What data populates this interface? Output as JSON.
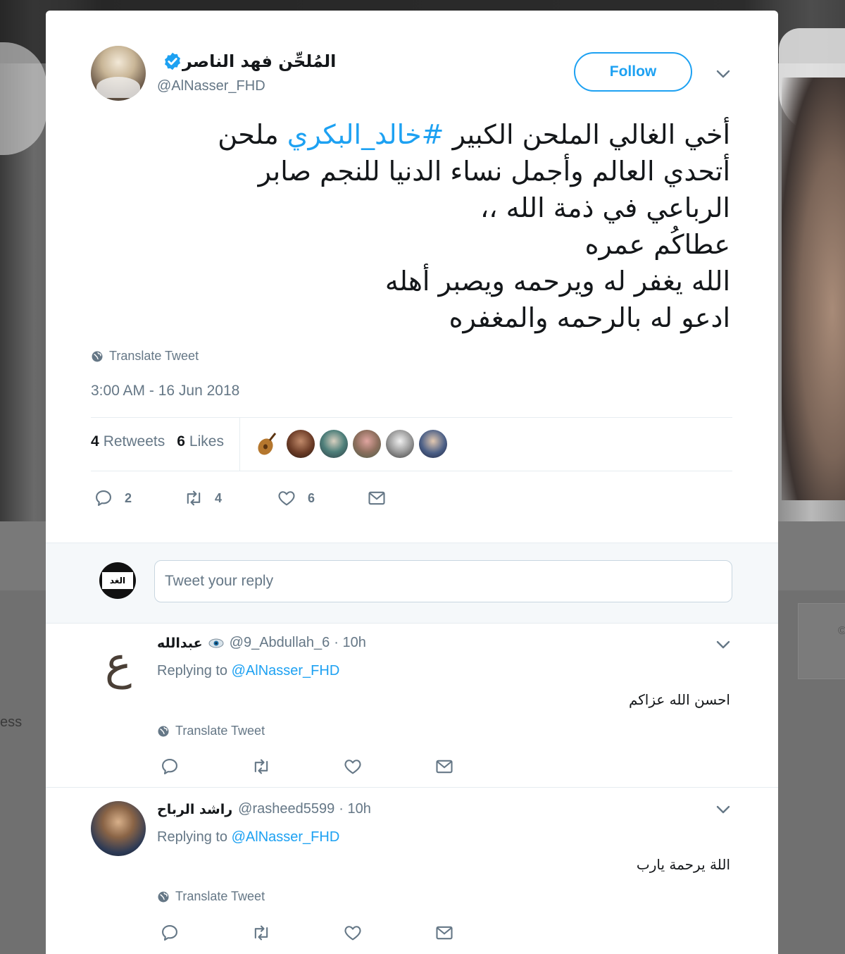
{
  "tweet": {
    "display_name": "المُلحِّن فهد الناصر",
    "handle": "@AlNasser_FHD",
    "follow_label": "Follow",
    "text_lines": [
      [
        "أخي الغالي  الملحن الكبير ",
        "#خالد_البكري",
        " ملحن"
      ],
      "أتحدي العالم وأجمل نساء الدنيا للنجم صابر",
      "الرباعي في ذمة الله ،،",
      "عطاكُم عمره",
      "الله  يغفر له ويرحمه ويصبر أهله",
      "ادعو له بالرحمه والمغفره"
    ],
    "translate_label": "Translate Tweet",
    "timestamp": "3:00 AM - 16 Jun 2018",
    "retweets_count": "4",
    "retweets_label": "Retweets",
    "likes_count": "6",
    "likes_label": "Likes",
    "actions": {
      "reply_count": "2",
      "retweet_count": "4",
      "like_count": "6"
    }
  },
  "reply_box": {
    "placeholder": "Tweet your reply",
    "avatar_text": "الغد"
  },
  "replies": [
    {
      "name": "عبدالله",
      "handle": "@9_Abdullah_6",
      "time": "· 10h",
      "replying_prefix": "Replying to",
      "replying_to": "@AlNasser_FHD",
      "text": "احسن الله عزاكم",
      "translate_label": "Translate Tweet",
      "avatar_glyph": "ع"
    },
    {
      "name": "راشد الرباح",
      "handle": "@rasheed5599",
      "time": "· 10h",
      "replying_prefix": "Replying to",
      "replying_to": "@AlNasser_FHD",
      "text": "اللة يرحمة يارب",
      "translate_label": "Translate Tweet"
    }
  ],
  "background": {
    "left_text": "ess",
    "side_card_text": "©"
  },
  "colors": {
    "accent": "#1da1f2",
    "text": "#14171a",
    "muted": "#657786",
    "border": "#e6ecf0"
  }
}
